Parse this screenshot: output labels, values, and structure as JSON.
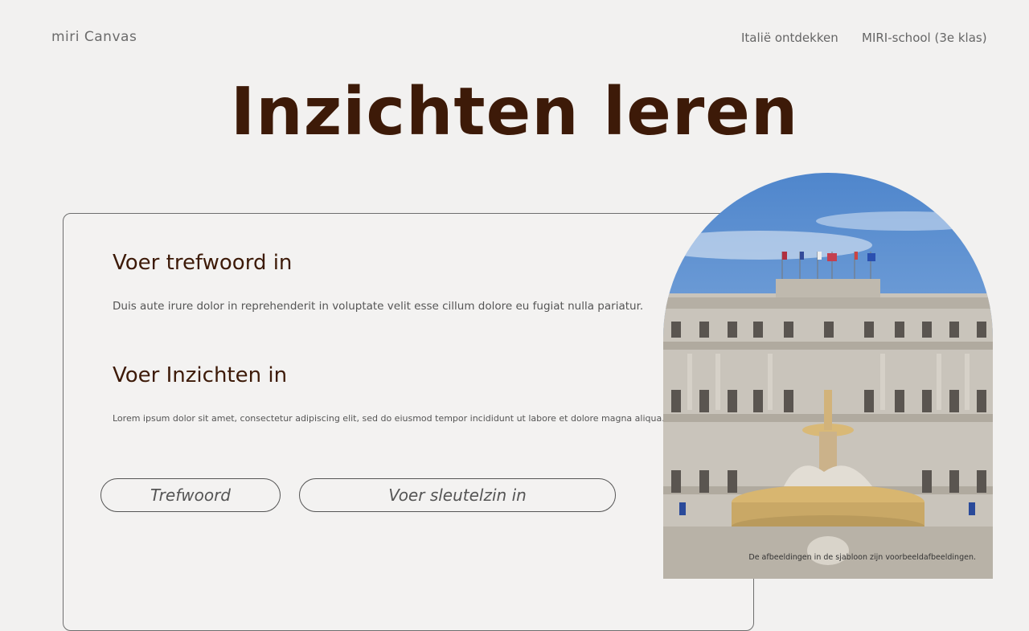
{
  "header": {
    "logo": "miri Canvas",
    "nav": [
      "Italië ontdekken",
      "MIRI-school (3e klas)"
    ]
  },
  "page": {
    "title": "Inzichten leren"
  },
  "card": {
    "heading_1": "Voer trefwoord in",
    "text_1": "Duis aute irure dolor in reprehenderit in voluptate velit esse cillum dolore eu fugiat nulla pariatur.",
    "heading_2": "Voer Inzichten in",
    "text_2": "Lorem ipsum dolor sit amet, consectetur adipiscing elit, sed do eiusmod tempor incididunt ut labore et dolore magna aliqua.",
    "button_1": "Trefwoord",
    "button_2": "Voer sleutelzin in"
  },
  "image": {
    "caption": "De afbeeldingen in de sjabloon zijn voorbeeldafbeeldingen."
  },
  "colors": {
    "background": "#f2f1f0",
    "title": "#3d1a08",
    "sky": "#5b8fd1"
  }
}
